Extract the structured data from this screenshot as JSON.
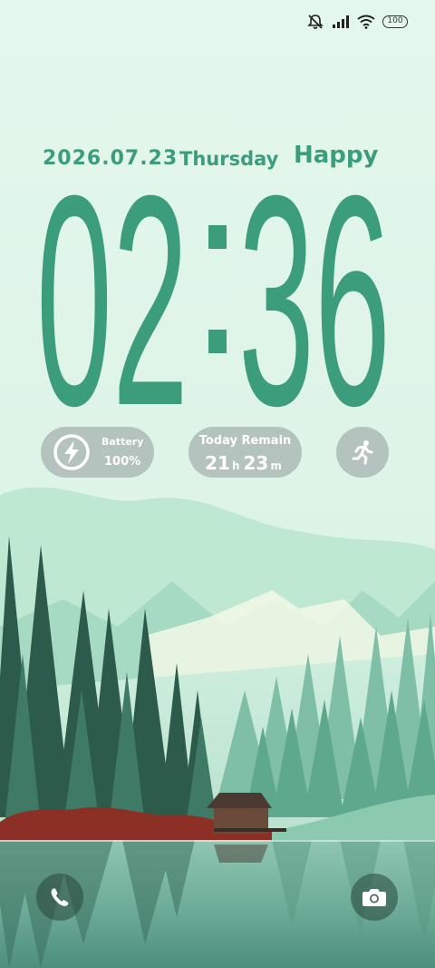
{
  "status_bar": {
    "battery_level": "100"
  },
  "header": {
    "date": "2026.07.23",
    "weekday": "Thursday",
    "greeting": "Happy"
  },
  "clock": {
    "hours": "02",
    "minutes": "36"
  },
  "widgets": {
    "battery": {
      "label": "Battery",
      "value": "100%"
    },
    "remain": {
      "label": "Today Remain",
      "hours": "21",
      "hours_unit": "h",
      "minutes": "23",
      "minutes_unit": "m"
    },
    "activity": {
      "icon": "running-icon"
    }
  },
  "dock": {
    "left_icon": "phone-icon",
    "right_icon": "camera-icon"
  },
  "colors": {
    "accent": "#3c9d7c",
    "background": "#e3f6ea",
    "pill": "#b4c3bd"
  }
}
